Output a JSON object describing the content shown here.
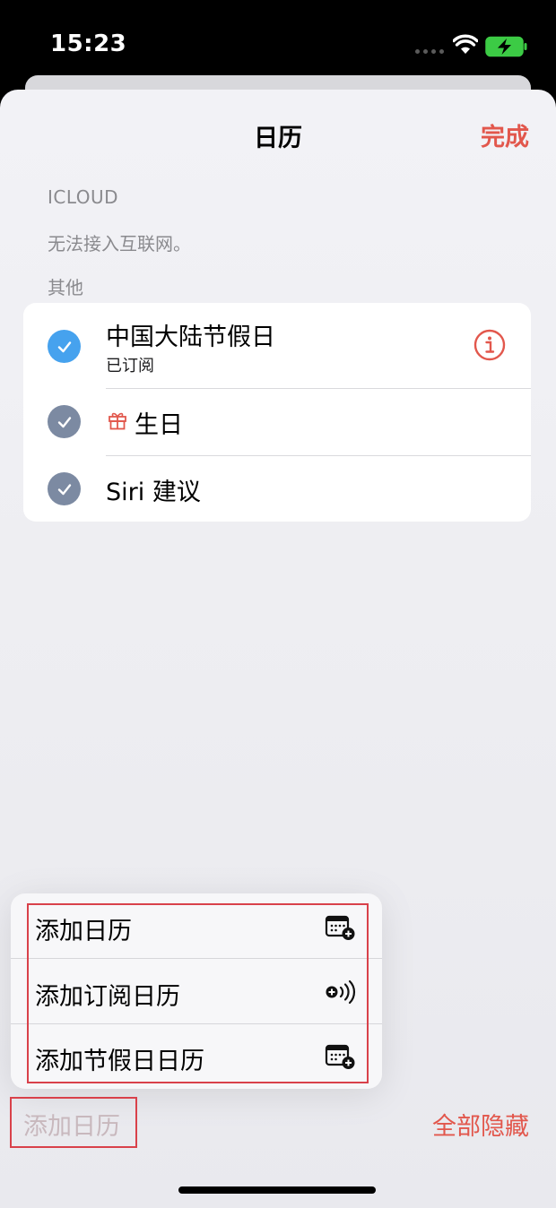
{
  "status_bar": {
    "time": "15:23",
    "icons": [
      "signal-icon",
      "wifi-icon",
      "battery-charging-icon"
    ]
  },
  "nav": {
    "title": "日历",
    "done_label": "完成"
  },
  "sections": {
    "icloud_header": "ICLOUD",
    "icloud_message": "无法接入互联网。",
    "other_header": "其他"
  },
  "calendars": [
    {
      "name": "中国大陆节假日",
      "subtitle": "已订阅",
      "checked": true,
      "check_color": "#46a2ee",
      "has_info": true
    },
    {
      "name": "生日",
      "checked": true,
      "check_color": "#7c8aa2",
      "icon": "gift-icon"
    },
    {
      "name": "Siri 建议",
      "checked": true,
      "check_color": "#7c8aa2"
    }
  ],
  "menu": {
    "items": [
      {
        "label": "添加日历",
        "icon": "calendar-add-icon"
      },
      {
        "label": "添加订阅日历",
        "icon": "subscribe-broadcast-icon"
      },
      {
        "label": "添加节假日日历",
        "icon": "calendar-add-icon"
      }
    ]
  },
  "toolbar": {
    "add_label": "添加日历",
    "hide_all_label": "全部隐藏"
  },
  "colors": {
    "accent": "#e2574c",
    "highlight_box": "#d9414a"
  }
}
